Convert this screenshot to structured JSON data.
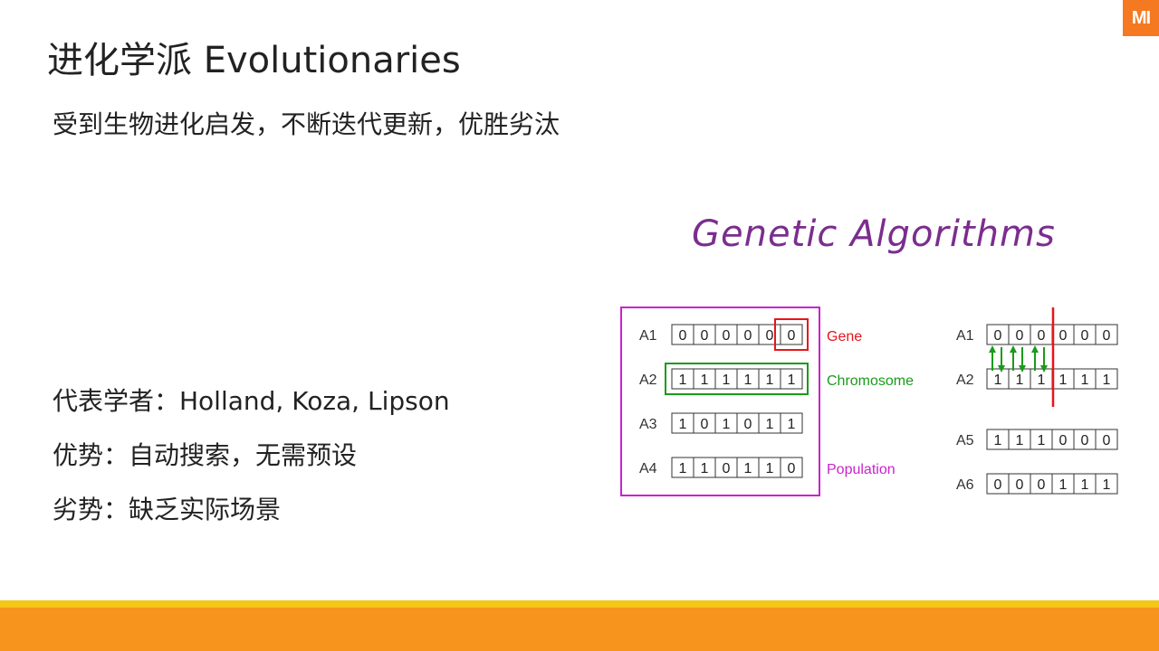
{
  "slide": {
    "logo": "MI",
    "title": "进化学派 Evolutionaries",
    "subtitle": "受到生物进化启发，不断迭代更新，优胜劣汰",
    "bullets": [
      "代表学者：Holland, Koza, Lipson",
      "优势：自动搜索，无需预设",
      "劣势：缺乏实际场景"
    ]
  },
  "diagram": {
    "title": "Genetic Algorithms",
    "left_rows": [
      {
        "label": "A1",
        "bits": [
          "0",
          "0",
          "0",
          "0",
          "0",
          "0"
        ]
      },
      {
        "label": "A2",
        "bits": [
          "1",
          "1",
          "1",
          "1",
          "1",
          "1"
        ]
      },
      {
        "label": "A3",
        "bits": [
          "1",
          "0",
          "1",
          "0",
          "1",
          "1"
        ]
      },
      {
        "label": "A4",
        "bits": [
          "1",
          "1",
          "0",
          "1",
          "1",
          "0"
        ]
      }
    ],
    "annotations": {
      "gene": "Gene",
      "chromosome": "Chromosome",
      "population": "Population"
    },
    "right_rows": [
      {
        "label": "A1",
        "bits": [
          "0",
          "0",
          "0",
          "0",
          "0",
          "0"
        ]
      },
      {
        "label": "A2",
        "bits": [
          "1",
          "1",
          "1",
          "1",
          "1",
          "1"
        ]
      },
      {
        "label": "A5",
        "bits": [
          "1",
          "1",
          "1",
          "0",
          "0",
          "0"
        ]
      },
      {
        "label": "A6",
        "bits": [
          "0",
          "0",
          "0",
          "1",
          "1",
          "1"
        ]
      }
    ],
    "colors": {
      "title": "#7b2d8e",
      "gene": "#e8141c",
      "chromosome": "#1a9a1a",
      "population": "#cc22cc",
      "accent_orange": "#f7941d",
      "accent_yellow": "#f5c518"
    }
  }
}
